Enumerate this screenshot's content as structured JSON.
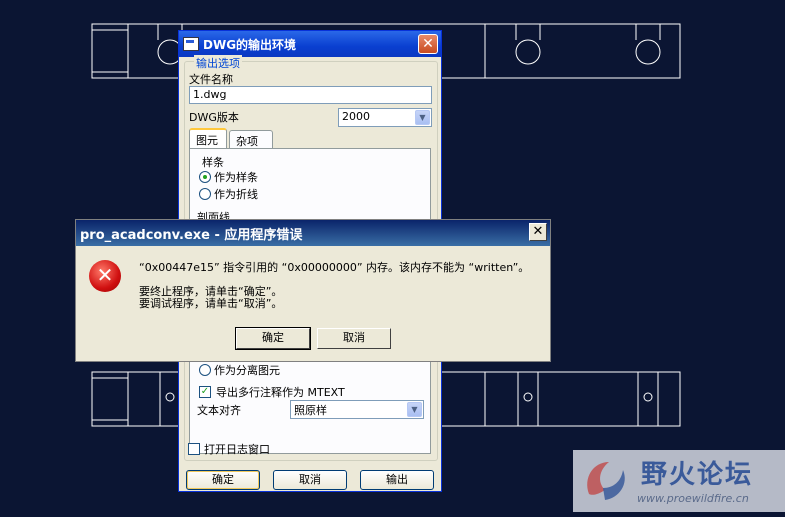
{
  "dwg_dialog": {
    "title": "DWG的输出环境",
    "group_label": "输出选项",
    "filename_label": "文件名称",
    "filename_value": "1.dwg",
    "version_label": "DWG版本",
    "version_value": "2000",
    "tabs": [
      "图元",
      "杂项"
    ],
    "spline_group": "样条",
    "spline_options": [
      "作为样条",
      "作为折线"
    ],
    "section_label": "剖面线",
    "as_separate": "作为分离图元",
    "mtext_label": "导出多行注释作为 MTEXT",
    "align_label": "文本对齐",
    "align_value": "照原样",
    "log_label": "打开日志窗口",
    "ok_label": "确定",
    "cancel_label": "取消",
    "export_label": "输出"
  },
  "error_dialog": {
    "title": "pro_acadconv.exe - 应用程序错误",
    "line1": "“0x00447e15” 指令引用的 “0x00000000” 内存。该内存不能为 “written”。",
    "line2": "要终止程序，请单击“确定”。",
    "line3": "要调试程序，请单击“取消”。",
    "ok_label": "确定",
    "cancel_label": "取消"
  },
  "watermark": {
    "name": "野火论坛",
    "url": "www.proewildfire.cn"
  },
  "colors": {
    "background": "#0b1533",
    "cad_lines": "#ffffff",
    "xp_title": "#0a3fd0"
  }
}
